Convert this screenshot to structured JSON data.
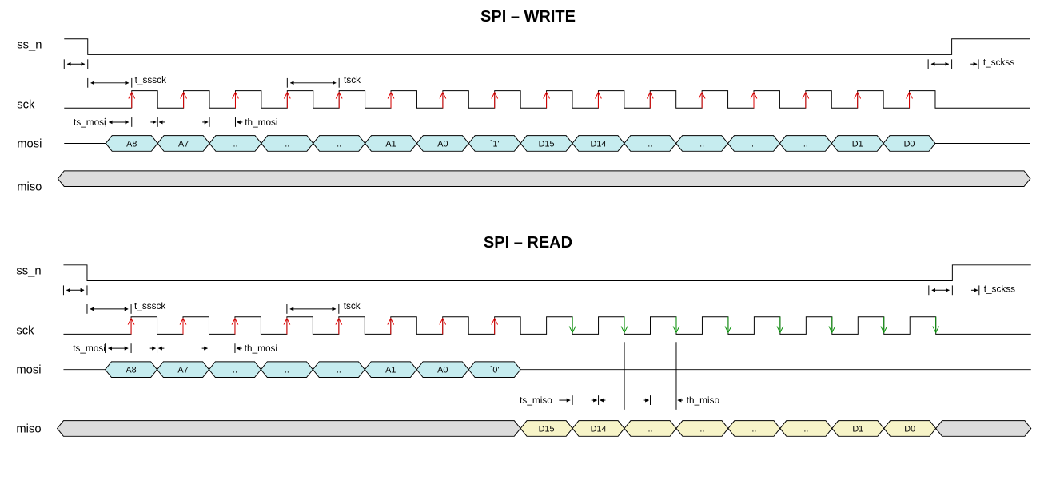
{
  "write": {
    "title": "SPI – WRITE",
    "signals": {
      "ss_n": "ss_n",
      "sck": "sck",
      "mosi": "mosi",
      "miso": "miso"
    },
    "timing": {
      "sssck": "t_sssck",
      "tsck": "tsck",
      "sckss": "t_sckss",
      "ts_mosi": "ts_mosi",
      "th_mosi": "th_mosi"
    },
    "mosi_cells": [
      "A8",
      "A7",
      "..",
      "..",
      "..",
      "A1",
      "A0",
      "`1'",
      "D15",
      "D14",
      "..",
      "..",
      "..",
      "..",
      "D1",
      "D0"
    ]
  },
  "read": {
    "title": "SPI – READ",
    "signals": {
      "ss_n": "ss_n",
      "sck": "sck",
      "mosi": "mosi",
      "miso": "miso"
    },
    "timing": {
      "sssck": "t_sssck",
      "tsck": "tsck",
      "sckss": "t_sckss",
      "ts_mosi": "ts_mosi",
      "th_mosi": "th_mosi",
      "ts_miso": "ts_miso",
      "th_miso": "th_miso"
    },
    "mosi_cells": [
      "A8",
      "A7",
      "..",
      "..",
      "..",
      "A1",
      "A0",
      "`0'"
    ],
    "miso_cells": [
      "D15",
      "D14",
      "..",
      "..",
      "..",
      "..",
      "D1",
      "D0"
    ]
  },
  "chart_data": [
    {
      "type": "timing-diagram",
      "title": "SPI – WRITE",
      "clock_periods": 16,
      "signals": {
        "ss_n": {
          "active_low": true,
          "asserted_for": "whole transaction"
        },
        "sck": {
          "periods": 16,
          "sample_edge": "rising"
        },
        "mosi": {
          "sequence": [
            "A8",
            "A7",
            "..",
            "..",
            "..",
            "A1",
            "A0",
            "`1'",
            "D15",
            "D14",
            "..",
            "..",
            "..",
            "..",
            "D1",
            "D0"
          ]
        },
        "miso": {
          "state": "undriven/don't-care"
        }
      },
      "timing_params": [
        "t_sssck",
        "tsck",
        "t_sckss",
        "ts_mosi",
        "th_mosi"
      ]
    },
    {
      "type": "timing-diagram",
      "title": "SPI – READ",
      "clock_periods": 16,
      "signals": {
        "ss_n": {
          "active_low": true,
          "asserted_for": "whole transaction"
        },
        "sck": {
          "periods": 16,
          "sample_edge_addr": "rising",
          "sample_edge_data": "falling"
        },
        "mosi": {
          "sequence": [
            "A8",
            "A7",
            "..",
            "..",
            "..",
            "A1",
            "A0",
            "`0'"
          ],
          "then": "idle"
        },
        "miso": {
          "before": "undriven/don't-care",
          "sequence": [
            "D15",
            "D14",
            "..",
            "..",
            "..",
            "..",
            "D1",
            "D0"
          ],
          "after": "undriven/don't-care"
        }
      },
      "timing_params": [
        "t_sssck",
        "tsck",
        "t_sckss",
        "ts_mosi",
        "th_mosi",
        "ts_miso",
        "th_miso"
      ]
    }
  ]
}
